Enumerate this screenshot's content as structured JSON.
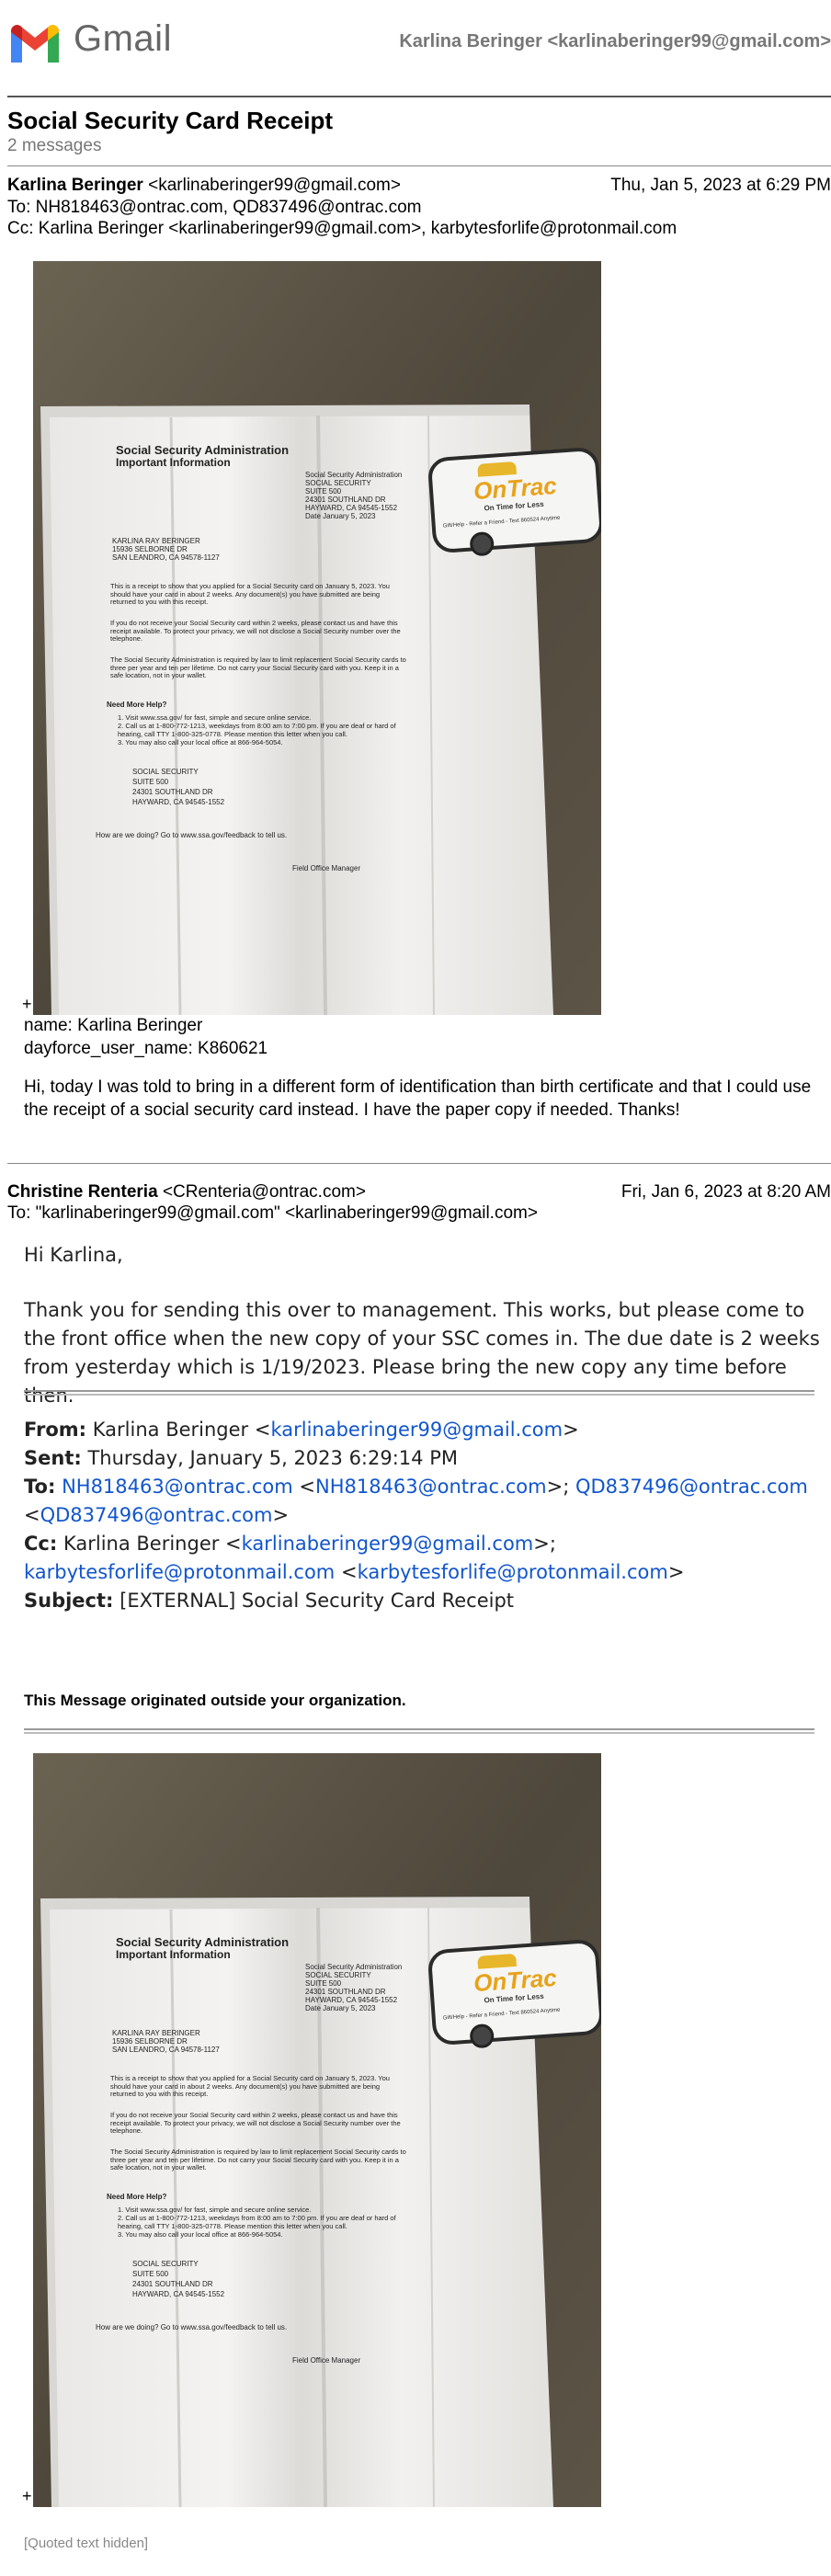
{
  "header": {
    "logo_text": "Gmail",
    "account": "Karlina Beringer <karlinaberinger99@gmail.com>"
  },
  "thread": {
    "subject": "Social Security Card Receipt",
    "count": "2 messages"
  },
  "msg1": {
    "from_name": "Karlina Beringer",
    "from_email": "<karlinaberinger99@gmail.com>",
    "date": "Thu, Jan 5, 2023 at 6:29 PM",
    "to": "To: NH818463@ontrac.com, QD837496@ontrac.com",
    "cc": "Cc: Karlina Beringer <karlinaberinger99@gmail.com>, karbytesforlife@protonmail.com",
    "plus": "+",
    "field_name": "name: Karlina Beringer",
    "field_user": "dayforce_user_name: K860621",
    "body": "Hi, today I was told to bring in a different form of identification than birth certificate and that I could use the receipt of a social security card instead. I have the paper copy if needed. Thanks!"
  },
  "letter": {
    "agency": "Social Security Administration",
    "subtitle": "Important Information",
    "addr_block": [
      "Social Security Administration",
      "SOCIAL SECURITY",
      "SUITE 500",
      "24301 SOUTHLAND DR",
      "HAYWARD, CA 94545-1552",
      "Date January 5, 2023"
    ],
    "recipient": [
      "KARLINA RAY BERINGER",
      "15936 SELBORNE DR",
      "SAN LEANDRO, CA 94578-1127"
    ],
    "p1": [
      "This is a receipt to show that you applied for a Social Security card on January 5, 2023.  You",
      "should have your card in about 2 weeks.  Any document(s) you have submitted are being",
      "returned to you with this receipt."
    ],
    "p2": [
      "If you do not receive your Social Security card within 2 weeks, please contact us and have this",
      "receipt available.  To protect your privacy, we will not disclose a Social Security number over the",
      "telephone."
    ],
    "p3": [
      "The Social Security Administration is required by law to limit replacement Social Security cards to",
      "three per year and ten per lifetime.  Do not carry your Social Security card with you.  Keep it in a",
      "safe location, not in your wallet."
    ],
    "help_title": "Need More Help?",
    "help": [
      "1. Visit www.ssa.gov/ for fast, simple and secure online service.",
      "2. Call us at 1-800-772-1213, weekdays from 8:00 am to 7:00 pm. If you are deaf or hard of",
      "    hearing, call TTY 1-800-325-0778. Please mention this letter when you call.",
      "3. You may also call your local office at 866-964-5054."
    ],
    "office": [
      "SOCIAL SECURITY",
      "SUITE 500",
      "24301 SOUTHLAND DR",
      "HAYWARD, CA 94545-1552"
    ],
    "feedback": "How are we doing? Go to www.ssa.gov/feedback to tell us.",
    "manager": "Field Office Manager",
    "badge_brand": "OnTrac",
    "badge_tag": "On Time for Less",
    "badge_foot": "Gift/Help - Refer a Friend - Text 860524 Anytime"
  },
  "msg2": {
    "from_name": "Christine Renteria",
    "from_email": "<CRenteria@ontrac.com>",
    "date": "Fri, Jan 6, 2023 at 8:20 AM",
    "to": "To: \"karlinaberinger99@gmail.com\" <karlinaberinger99@gmail.com>",
    "greeting": "Hi Karlina,",
    "body": "Thank you for sending this over to management. This works, but please come to the front office when the new copy of your SSC comes in. The due date is 2 weeks from yesterday which is 1/19/2023. Please bring the new copy any time before then.",
    "q_from_label": "From:",
    "q_from_name": "Karlina Beringer <",
    "q_from_link": "karlinaberinger99@gmail.com",
    "q_from_end": ">",
    "q_sent_label": "Sent:",
    "q_sent": "Thursday, January 5, 2023 6:29:14 PM",
    "q_to_label": "To:",
    "q_to_link1": "NH818463@ontrac.com",
    "q_to_mid1": " <",
    "q_to_link2": "NH818463@ontrac.com",
    "q_to_mid2": ">; ",
    "q_to_link3": "QD837496@ontrac.com",
    "q_to_mid3": " <",
    "q_to_link4": "QD837496@ontrac.com",
    "q_to_end": ">",
    "q_cc_label": "Cc:",
    "q_cc_name": "Karlina Beringer <",
    "q_cc_link1": "karlinaberinger99@gmail.com",
    "q_cc_mid": ">; ",
    "q_cc_link2": "karbytesforlife@protonmail.com",
    "q_cc_mid2": " <",
    "q_cc_link3": "karbytesforlife@protonmail.com",
    "q_cc_end": ">",
    "q_subject_label": "Subject:",
    "q_subject": "[EXTERNAL] Social Security Card Receipt",
    "warning": "This Message originated outside your organization.",
    "plus": "+",
    "quoted_hidden": "[Quoted text hidden]"
  }
}
